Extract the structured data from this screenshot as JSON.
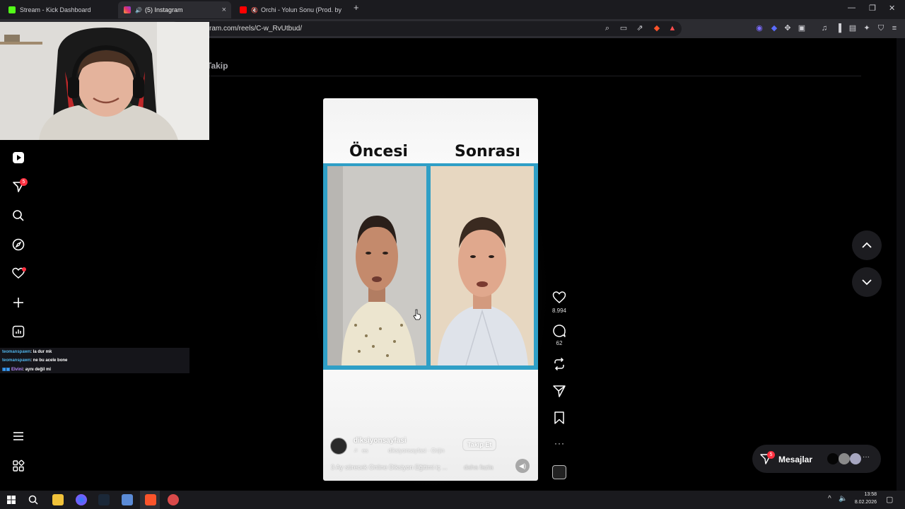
{
  "browser": {
    "tabs": [
      {
        "title": "Stream - Kick Dashboard",
        "icon": "kick-icon",
        "color": "#53fc18"
      },
      {
        "title": "(5) Instagram",
        "icon": "instagram-icon",
        "color": "#e1306c"
      },
      {
        "title": "Orchi - Yolun Sonu (Prod. by akca",
        "icon": "youtube-icon",
        "color": "#ff0000"
      }
    ],
    "url": "ram.com/reels/C-w_RvUtbud/"
  },
  "page": {
    "follow_label": "Takip"
  },
  "sidebar": {
    "notification_count": "5"
  },
  "chat": {
    "messages": [
      {
        "user": "teomanspawn",
        "text": ": la dur mk"
      },
      {
        "user": "teomanspawn",
        "text": ": ne bu acele bone"
      },
      {
        "user": "Elvini",
        "text": ": aynı değil mi"
      }
    ]
  },
  "reel": {
    "before_label": "Öncesi",
    "after_label": "Sonrası",
    "username": "diksiyonsayfasi",
    "audio_prefix": "es",
    "audio_text": "diksiyonsayfasi · Orijin",
    "follow_button": "Takip Et",
    "caption": "3 Ay sürecek Online Diksiyon Eğitimi iç ...",
    "more_label": "daha fazla",
    "likes": "8.994",
    "comments": "62",
    "frame_color": "#2f9fc6"
  },
  "messages": {
    "label": "Mesajlar",
    "badge": "5"
  },
  "taskbar": {
    "time": "13:58",
    "date": "8.02.2026"
  }
}
